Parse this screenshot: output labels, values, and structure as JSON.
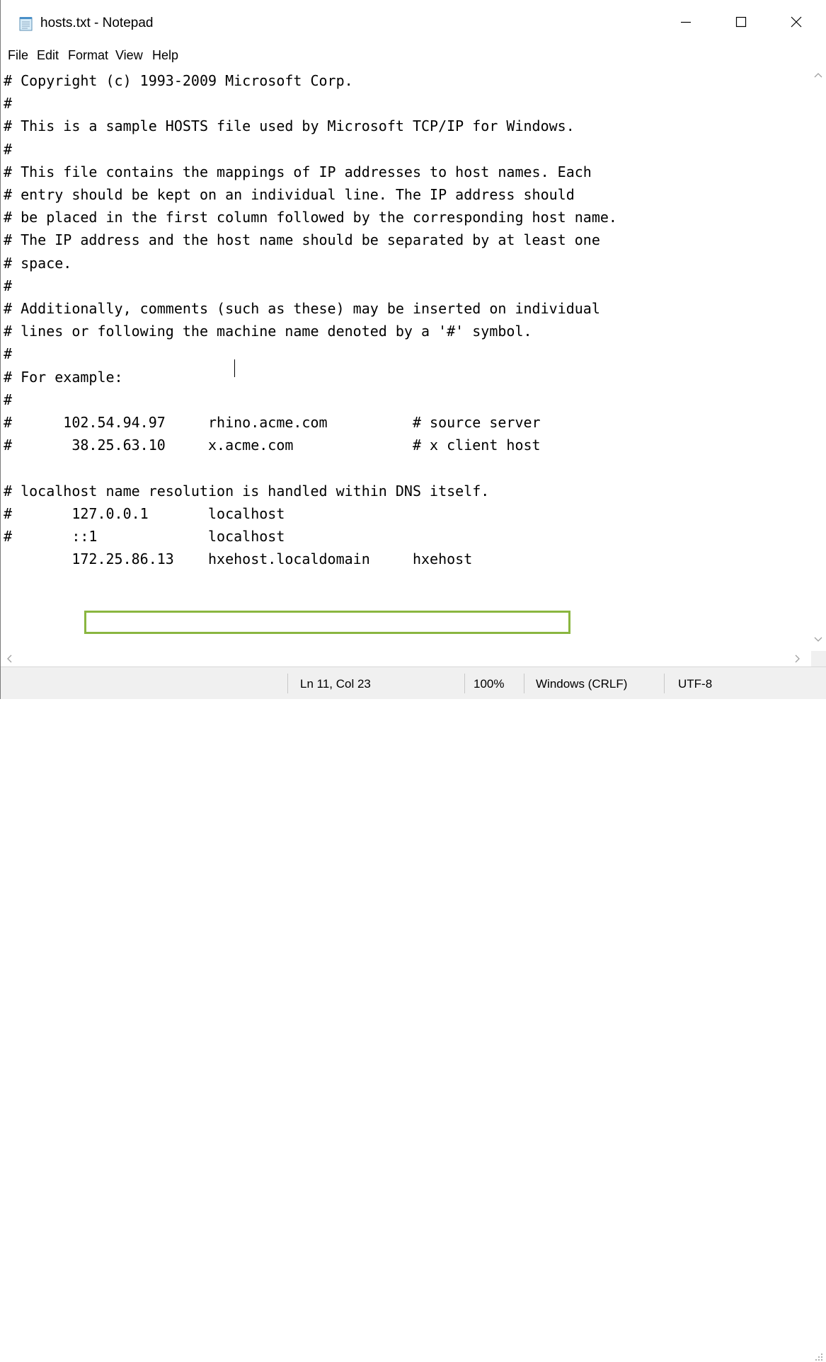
{
  "window": {
    "title": "hosts.txt - Notepad",
    "icon": "notepad-icon"
  },
  "title_controls": {
    "minimize_icon": "minimize-icon",
    "maximize_icon": "maximize-icon",
    "close_icon": "close-icon"
  },
  "menu": {
    "items": [
      "File",
      "Edit",
      "Format",
      "View",
      "Help"
    ]
  },
  "editor": {
    "lines": [
      "# Copyright (c) 1993-2009 Microsoft Corp.",
      "#",
      "# This is a sample HOSTS file used by Microsoft TCP/IP for Windows.",
      "#",
      "# This file contains the mappings of IP addresses to host names. Each",
      "# entry should be kept on an individual line. The IP address should",
      "# be placed in the first column followed by the corresponding host name.",
      "# The IP address and the host name should be separated by at least one",
      "# space.",
      "#",
      "# Additionally, comments (such as these) may be inserted on individual",
      "# lines or following the machine name denoted by a '#' symbol.",
      "#",
      "# For example:",
      "#",
      "#      102.54.94.97     rhino.acme.com          # source server",
      "#       38.25.63.10     x.acme.com              # x client host",
      "",
      "# localhost name resolution is handled within DNS itself.",
      "#\t127.0.0.1       localhost",
      "#\t::1             localhost",
      "\t172.25.86.13    hxehost.localdomain     hxehost"
    ],
    "highlight_color": "#8ab640"
  },
  "statusbar": {
    "position": "Ln 11, Col 23",
    "zoom": "100%",
    "line_ending": "Windows (CRLF)",
    "encoding": "UTF-8"
  }
}
